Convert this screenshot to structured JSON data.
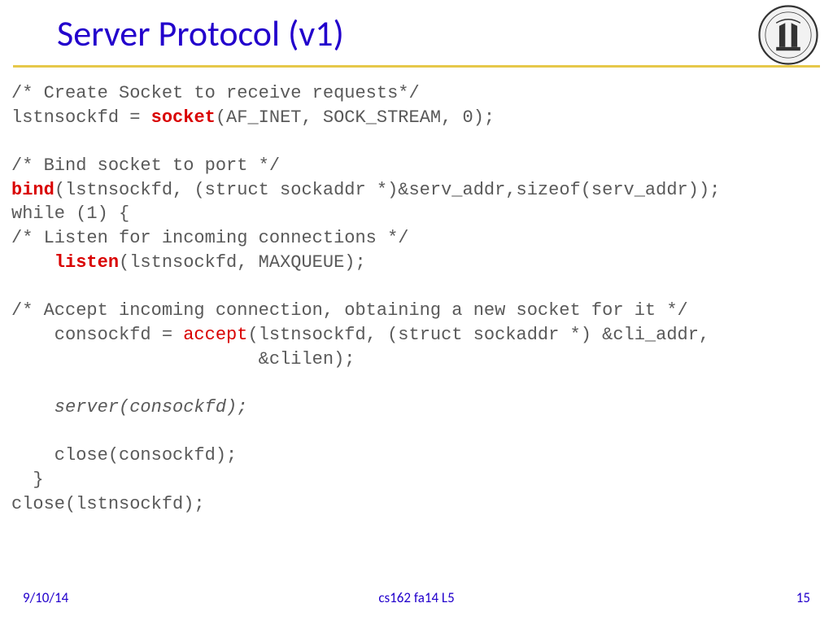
{
  "title": "Server Protocol (v1)",
  "code": {
    "l01": "/* Create Socket to receive requests*/",
    "l02a": "lstnsockfd = ",
    "l02b": "socket",
    "l02c": "(AF_INET, SOCK_STREAM, 0);",
    "l03": "",
    "l04": "/* Bind socket to port */",
    "l05a": "bind",
    "l05b": "(lstnsockfd, (struct sockaddr *)&serv_addr,sizeof(serv_addr)); ",
    "l06": "while (1) {",
    "l07": "/* Listen for incoming connections */",
    "l08a": "    ",
    "l08b": "listen",
    "l08c": "(lstnsockfd, MAXQUEUE); ",
    "l09": "",
    "l10": "/* Accept incoming connection, obtaining a new socket for it */",
    "l11a": "    consockfd = ",
    "l11b": "accept",
    "l11c": "(lstnsockfd, (struct sockaddr *) &cli_addr,",
    "l12": "                       &clilen);",
    "l13": "",
    "l14": "    server(consockfd);",
    "l15": "",
    "l16": "    close(consockfd);",
    "l17": "  }",
    "l18": "close(lstnsockfd);"
  },
  "footer": {
    "date": "9/10/14",
    "course": "cs162 fa14 L5",
    "page": "15"
  }
}
